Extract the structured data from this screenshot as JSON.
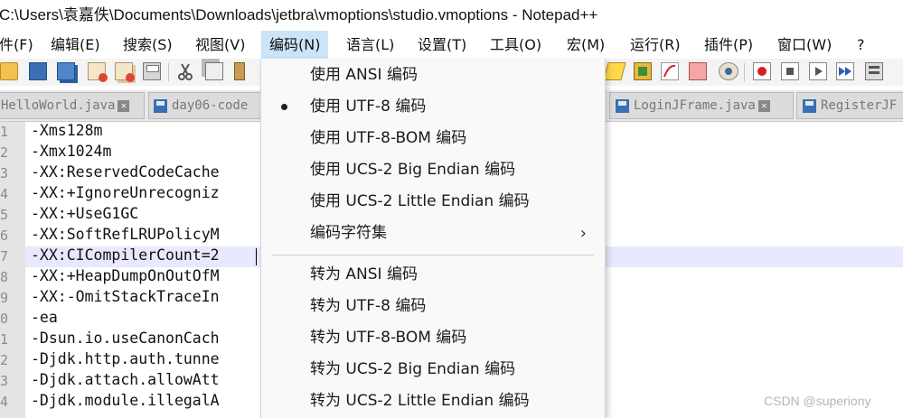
{
  "window": {
    "title": "C:\\Users\\袁嘉佚\\Documents\\Downloads\\jetbra\\vmoptions\\studio.vmoptions - Notepad++"
  },
  "menubar": {
    "items": [
      "件(F)",
      "编辑(E)",
      "搜索(S)",
      "视图(V)",
      "编码(N)",
      "语言(L)",
      "设置(T)",
      "工具(O)",
      "宏(M)",
      "运行(R)",
      "插件(P)",
      "窗口(W)",
      "?"
    ],
    "active": "编码(N)"
  },
  "toolbar": {
    "icons": [
      "open-icon",
      "save-icon",
      "save-all-icon",
      "close-icon",
      "close-all-icon",
      "print-icon",
      "cut-icon",
      "copy-icon",
      "paste-icon",
      "function-list-icon",
      "document-map-icon",
      "monitoring-icon",
      "folder-workspace-icon",
      "eye-icon",
      "record-macro-icon",
      "stop-record-icon",
      "playback-icon",
      "run-macro-multiple-icon",
      "save-macro-icon"
    ]
  },
  "tabs": [
    {
      "label": "HelloWorld.java",
      "close": "✕"
    },
    {
      "label": "day06-code"
    },
    {
      "label": "LoginJFrame.java",
      "close": "✕"
    },
    {
      "label": "RegisterJF"
    }
  ],
  "editor": {
    "line_numbers": [
      "1",
      "2",
      "3",
      "4",
      "5",
      "6",
      "7",
      "8",
      "9",
      "0",
      "1",
      "2",
      "3",
      "4"
    ],
    "lines": [
      "-Xms128m",
      "-Xmx1024m",
      "-XX:ReservedCodeCache",
      "-XX:+IgnoreUnrecogniz",
      "-XX:+UseG1GC",
      "-XX:SoftRefLRUPolicyM",
      "-XX:CICompilerCount=2",
      "-XX:+HeapDumpOnOutOfM",
      "-XX:-OmitStackTraceIn",
      "-ea",
      "-Dsun.io.useCanonCach",
      "-Djdk.http.auth.tunne",
      "-Djdk.attach.allowAtt",
      "-Djdk.module.illegalA"
    ],
    "current_line_index": 6
  },
  "encoding_menu": {
    "group1": [
      {
        "label": "使用 ANSI 编码",
        "checked": false
      },
      {
        "label": "使用 UTF-8 编码",
        "checked": true
      },
      {
        "label": "使用 UTF-8-BOM 编码",
        "checked": false
      },
      {
        "label": "使用 UCS-2 Big Endian 编码",
        "checked": false
      },
      {
        "label": "使用 UCS-2 Little Endian 编码",
        "checked": false
      },
      {
        "label": "编码字符集",
        "submenu": true
      }
    ],
    "submenu_arrow": "›",
    "group2": [
      {
        "label": "转为 ANSI 编码"
      },
      {
        "label": "转为 UTF-8 编码"
      },
      {
        "label": "转为 UTF-8-BOM 编码"
      },
      {
        "label": "转为 UCS-2 Big Endian 编码"
      },
      {
        "label": "转为 UCS-2 Little Endian 编码"
      }
    ]
  },
  "watermark": "CSDN @superiony",
  "colors": {
    "menu_highlight": "#cce4f7",
    "current_line": "#e8e8ff",
    "gutter": "#e4e4e4",
    "menu_bg": "#f9f9f9"
  }
}
